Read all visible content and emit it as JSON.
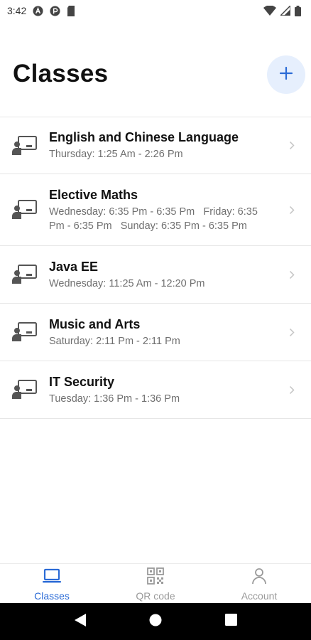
{
  "status_bar": {
    "time": "3:42",
    "icons": [
      "app-a-icon",
      "app-p-icon",
      "sd-card-icon",
      "wifi-icon",
      "signal-icon",
      "battery-icon"
    ]
  },
  "header": {
    "title": "Classes",
    "add_icon": "plus-icon"
  },
  "colors": {
    "accent": "#2b6bd6",
    "add_button_bg": "#e6effd",
    "muted_text": "#6f6f6f",
    "divider": "#e6e6e6"
  },
  "classes": [
    {
      "name": "English and Chinese Language",
      "schedule": "Thursday: 1:25 Am - 2:26 Pm"
    },
    {
      "name": "Elective Maths",
      "schedule": "Wednesday: 6:35 Pm - 6:35 Pm   Friday: 6:35 Pm - 6:35 Pm   Sunday: 6:35 Pm - 6:35 Pm"
    },
    {
      "name": "Java EE",
      "schedule": "Wednesday: 11:25 Am - 12:20 Pm"
    },
    {
      "name": "Music and Arts",
      "schedule": "Saturday: 2:11 Pm - 2:11 Pm"
    },
    {
      "name": "IT Security",
      "schedule": "Tuesday: 1:36 Pm - 1:36 Pm"
    }
  ],
  "bottom_nav": {
    "tabs": [
      {
        "label": "Classes",
        "icon": "laptop-icon",
        "active": true
      },
      {
        "label": "QR code",
        "icon": "qr-code-icon",
        "active": false
      },
      {
        "label": "Account",
        "icon": "person-icon",
        "active": false
      }
    ]
  },
  "system_nav": {
    "buttons": [
      "back-icon",
      "home-icon",
      "recents-icon"
    ]
  }
}
